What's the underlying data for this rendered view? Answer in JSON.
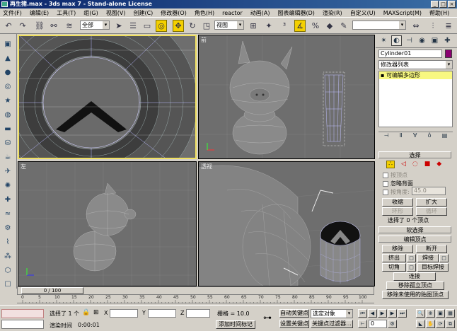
{
  "window": {
    "title": "再生猪.max - 3ds max 7 - Stand-alone License",
    "minimize": "_",
    "maximize": "□",
    "close": "×"
  },
  "menu": [
    "文件(F)",
    "编辑(E)",
    "工具(T)",
    "组(G)",
    "视图(V)",
    "创建(C)",
    "修改器(O)",
    "角色(H)",
    "reactor",
    "动画(A)",
    "图表编辑器(D)",
    "渲染(R)",
    "自定义(U)",
    "MAXScript(M)",
    "帮助(H)"
  ],
  "toolbar": {
    "selection_filter": "全部",
    "reference_coord": "视图",
    "named_selection": ""
  },
  "viewports": {
    "top_left": {
      "label": ""
    },
    "top_right": {
      "label": "前"
    },
    "bottom_left": {
      "label": "左"
    },
    "bottom_right": {
      "label": "透视"
    }
  },
  "timeslider": {
    "frame": "0 / 100"
  },
  "ruler": [
    "0",
    "5",
    "10",
    "15",
    "20",
    "25",
    "30",
    "35",
    "40",
    "45",
    "50",
    "55",
    "60",
    "65",
    "70",
    "75",
    "80",
    "85",
    "90",
    "95",
    "100"
  ],
  "command_panel": {
    "object_name": "Cylinder01",
    "object_color": "#8b0070",
    "modifier_list": "修改器列表",
    "stack_item": "可编辑多边形",
    "selection": {
      "header": "选择",
      "by_vertex": "按顶点",
      "ignore_backfacing": "忽略背面",
      "by_angle": "按角度:",
      "angle_value": "45.0",
      "shrink": "收缩",
      "grow": "扩大",
      "ring": "环形",
      "loop": "循环",
      "selected_info": "选择了 0 个顶点"
    },
    "soft_selection": {
      "header": "软选择"
    },
    "edit_vertices": {
      "header": "编辑顶点",
      "remove": "移除",
      "break": "断开",
      "extrude": "挤出",
      "weld": "焊接",
      "chamfer": "切角",
      "target_weld": "目标焊接",
      "connect": "连接",
      "remove_isolated": "移除孤立顶点",
      "remove_unused_map": "移除未使用的贴图顶点"
    }
  },
  "status": {
    "selection_info": "选择了 1 个",
    "x_label": "X",
    "y_label": "Y",
    "z_label": "Z",
    "grid": "栅格 = 10.0",
    "add_time_tag": "添加时间标记",
    "auto_key": "自动关键点",
    "selected_objects": "选定对象",
    "set_key": "设置关键点",
    "key_filters": "关键点过滤器...",
    "frame": "0",
    "prompt": "渲染时间",
    "time": "0:00:01"
  }
}
